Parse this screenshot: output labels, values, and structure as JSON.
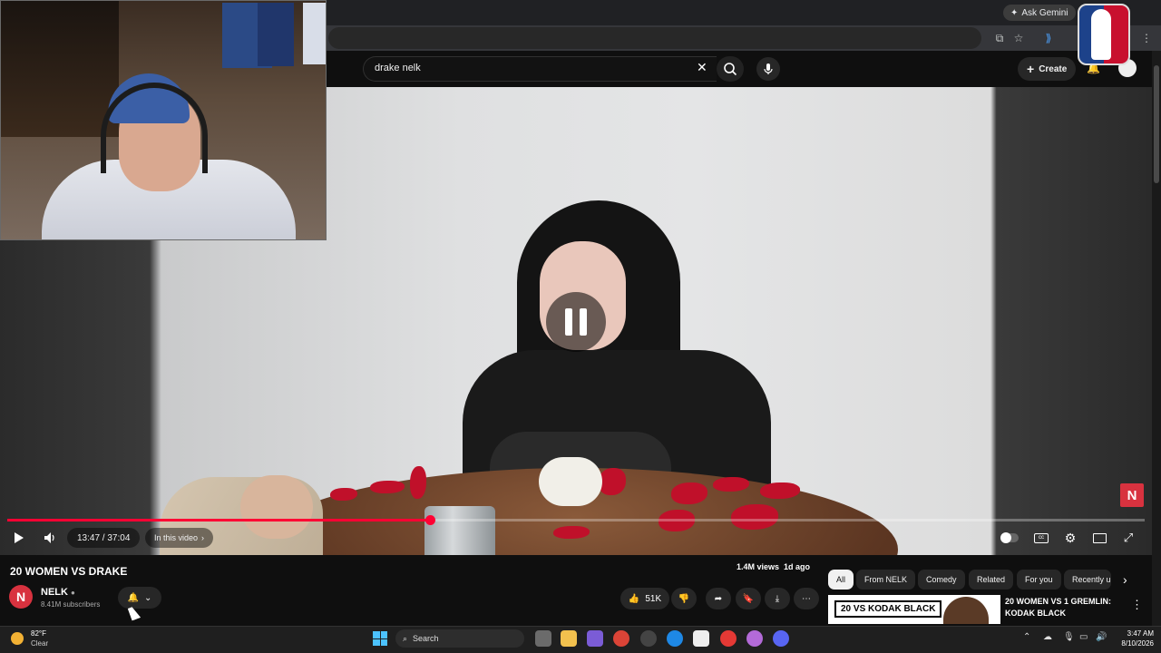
{
  "browser": {
    "ask_gemini": "Ask Gemini"
  },
  "search": {
    "query": "drake nelk"
  },
  "header": {
    "create_label": "Create"
  },
  "player": {
    "time": "13:47 / 37:04",
    "progress_fraction": 0.372,
    "chapter_label": "In this video",
    "badge_letter": "N"
  },
  "video": {
    "title": "20 WOMEN VS DRAKE",
    "views_date": "1.4M views  1d ago",
    "channel": "NELK",
    "channel_initial": "N",
    "subscribers": "8.41M subscribers",
    "likes": "51K"
  },
  "chips": [
    "All",
    "From NELK",
    "Comedy",
    "Related",
    "For you",
    "Recently u"
  ],
  "recommendation": {
    "thumb_label": "20 VS KODAK BLACK",
    "title": "20 WOMEN VS 1 GREMLIN: KODAK BLACK"
  },
  "taskbar": {
    "temperature": "82°F",
    "condition": "Clear",
    "search_label": "Search",
    "time": "3:47 AM",
    "date": "8/10/2026"
  },
  "colors": {
    "accent_red": "#ff0033",
    "nelk_red": "#d8323f"
  }
}
